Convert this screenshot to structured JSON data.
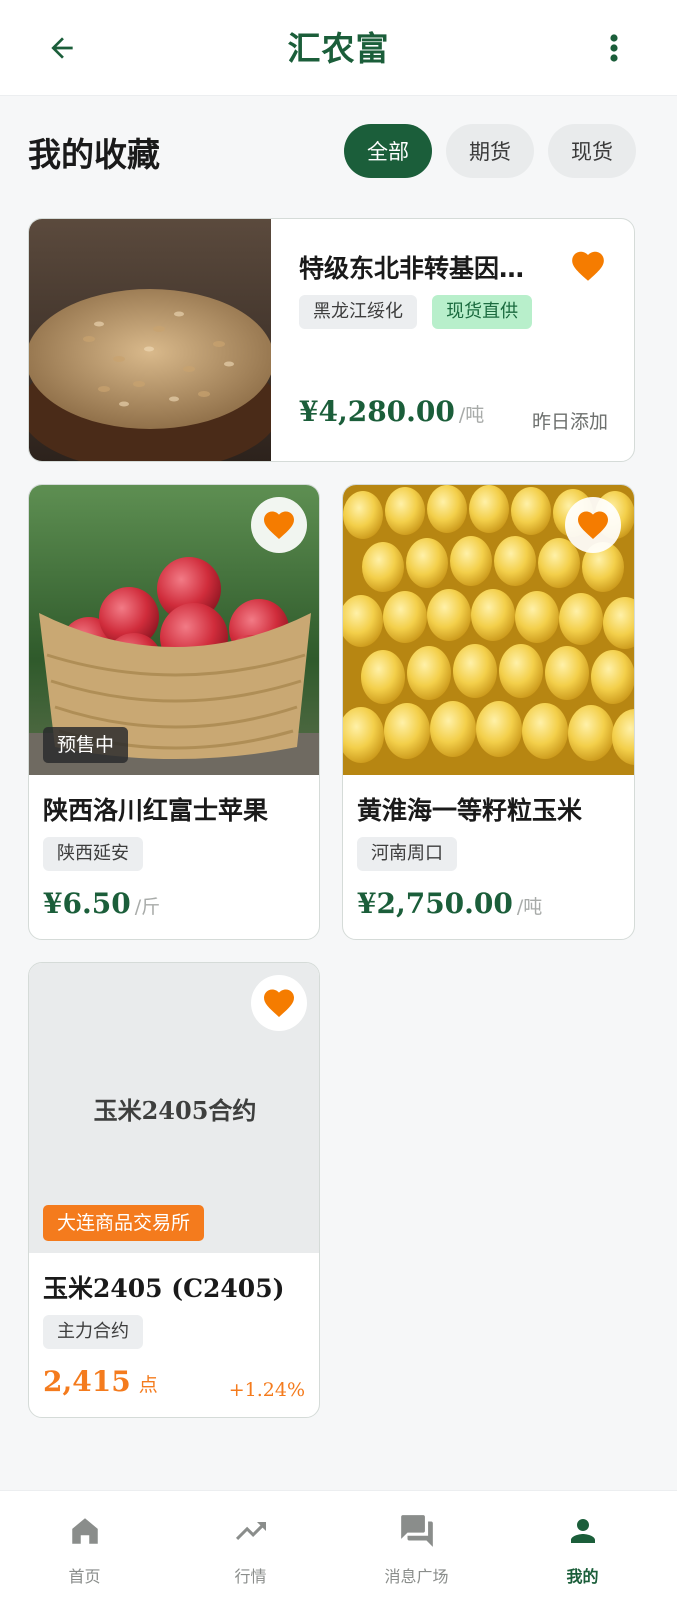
{
  "header": {
    "title": "汇农富",
    "back_icon": "arrow-left-icon",
    "more_icon": "more-vertical-icon"
  },
  "section": {
    "title": "我的收藏",
    "tabs": [
      {
        "label": "全部",
        "active": true
      },
      {
        "label": "期货",
        "active": false
      },
      {
        "label": "现货",
        "active": false
      }
    ]
  },
  "items": [
    {
      "title": "特级东北非转基因…",
      "tags": [
        "黑龙江绥化",
        "现货直供"
      ],
      "price": "¥4,280.00",
      "unit": "/吨",
      "added": "昨日添加",
      "image": "wheat-bowl",
      "favorited": true
    },
    {
      "title": "陕西洛川红富士苹果",
      "badge": "预售中",
      "tags": [
        "陕西延安"
      ],
      "price": "¥6.50",
      "unit": "/斤",
      "image": "apple-basket",
      "favorited": true
    },
    {
      "title": "黄淮海一等籽粒玉米",
      "tags": [
        "河南周口"
      ],
      "price": "¥2,750.00",
      "unit": "/吨",
      "image": "corn-cob",
      "favorited": true
    },
    {
      "placeholder": "玉米2405合约",
      "badge": "大连商品交易所",
      "title": "玉米2405 (C2405)",
      "tags": [
        "主力合约"
      ],
      "price": "2,415",
      "unit": "点",
      "change": "+1.24%",
      "favorited": true
    }
  ],
  "bottom_nav": [
    {
      "label": "首页",
      "icon": "home-icon",
      "active": false
    },
    {
      "label": "行情",
      "icon": "trending-up-icon",
      "active": false
    },
    {
      "label": "消息广场",
      "icon": "forum-icon",
      "active": false
    },
    {
      "label": "我的",
      "icon": "person-icon",
      "active": true
    }
  ],
  "colors": {
    "primary": "#1b5e3a",
    "accent_orange": "#f47b1d",
    "heart": "#f57c00",
    "chip_green_bg": "#b8efcb"
  }
}
